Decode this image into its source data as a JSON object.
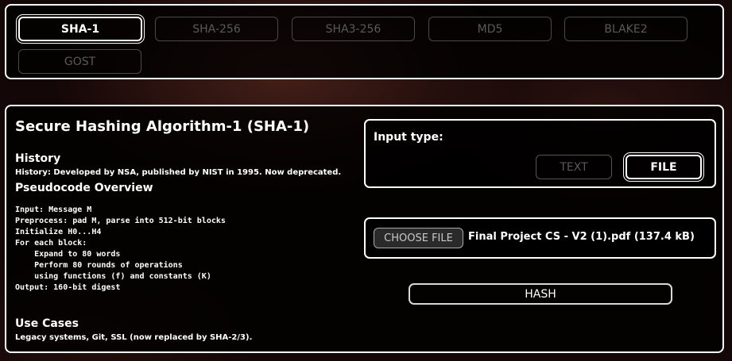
{
  "algorithms": {
    "items": [
      {
        "label": "SHA-1",
        "active": true
      },
      {
        "label": "SHA-256",
        "active": false
      },
      {
        "label": "SHA3-256",
        "active": false
      },
      {
        "label": "MD5",
        "active": false
      },
      {
        "label": "BLAKE2",
        "active": false
      },
      {
        "label": "GOST",
        "active": false
      }
    ]
  },
  "info": {
    "title": "Secure Hashing Algorithm-1 (SHA-1)",
    "history_heading": "History",
    "history_text": "History: Developed by NSA, published by NIST in 1995. Now deprecated.",
    "pseudocode_heading": "Pseudocode Overview",
    "pseudocode": "Input: Message M\nPreprocess: pad M, parse into 512-bit blocks\nInitialize H0...H4\nFor each block:\n    Expand to 80 words\n    Perform 80 rounds of operations\n    using functions (f) and constants (K)\nOutput: 160-bit digest",
    "use_cases_heading": "Use Cases",
    "use_cases_text": "Legacy systems, Git, SSL (now replaced by SHA-2/3)."
  },
  "input_type": {
    "label": "Input type:",
    "options": {
      "text": "TEXT",
      "file": "FILE"
    },
    "selected": "FILE"
  },
  "file": {
    "choose_label": "CHOOSE FILE",
    "selected_file": "Final Project CS - V2 (1).pdf (137.4 kB)"
  },
  "hash_button_label": "HASH",
  "colors": {
    "background": "#140707",
    "panel_border": "#ffffff",
    "inactive_text": "#5a5a5a",
    "active_text": "#ffffff"
  }
}
